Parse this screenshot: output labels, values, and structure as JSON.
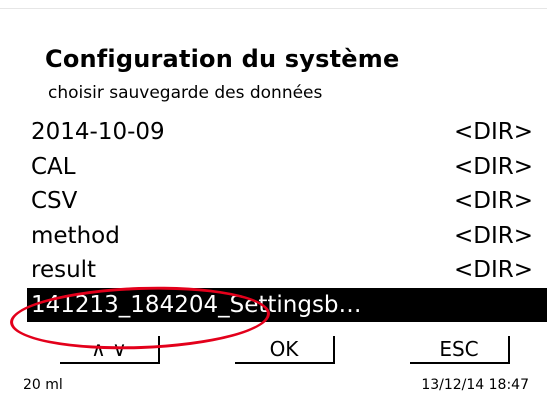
{
  "header": {
    "title": "Configuration du système",
    "subtitle": "choisir sauvegarde des données"
  },
  "list": {
    "items": [
      {
        "name": "2014-10-09",
        "tag": "<DIR>"
      },
      {
        "name": "CAL",
        "tag": "<DIR>"
      },
      {
        "name": "CSV",
        "tag": "<DIR>"
      },
      {
        "name": "method",
        "tag": "<DIR>"
      },
      {
        "name": "result",
        "tag": "<DIR>"
      },
      {
        "name": "141213_184204_Settingsb…",
        "tag": ""
      }
    ],
    "selected_index": 5
  },
  "buttons": {
    "nav_label": "∧ ∨",
    "ok_label": "OK",
    "esc_label": "ESC"
  },
  "status": {
    "volume": "20 ml",
    "datetime": "13/12/14 18:47"
  },
  "colors": {
    "annotation": "#e3001b",
    "selection_bg": "#000000"
  }
}
